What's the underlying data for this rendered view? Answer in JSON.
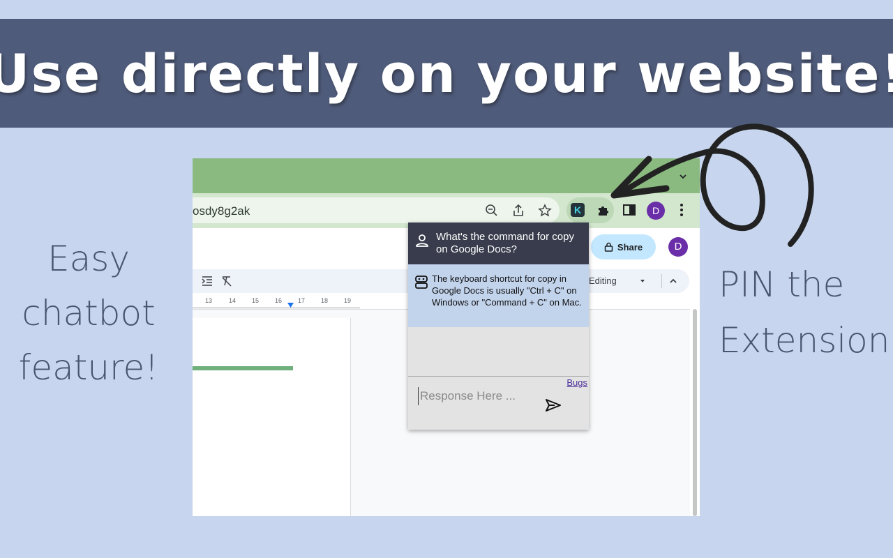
{
  "banner": {
    "title": "Use directly on your website!"
  },
  "left_note": {
    "lines": [
      "Easy",
      "chatbot",
      "feature!"
    ]
  },
  "right_note": {
    "lines": [
      "PIN the",
      "Extension!"
    ]
  },
  "browser": {
    "url": "osdy8g2ak",
    "extension_letter": "K",
    "profile_initial": "D"
  },
  "docs": {
    "share_label": "Share",
    "avatar_initial": "D",
    "mode_label": "Editing",
    "ruler_ticks": [
      "13",
      "14",
      "15",
      "16",
      "17",
      "18",
      "19"
    ]
  },
  "chatbot": {
    "user_message": "What's the command for copy on Google Docs?",
    "bot_message": "The keyboard shortcut for copy in Google Docs is usually \"Ctrl + C\" on Windows or \"Command + C\" on Mac.",
    "bugs_link": "Bugs",
    "input_placeholder": "Response Here ..."
  },
  "colors": {
    "background": "#c7d6ee",
    "banner": "#4f5b7a",
    "tab_bar": "#8aba80",
    "popup_header": "#383c4c",
    "bot_bubble": "#c2d3ec"
  },
  "icons": [
    "zoom-out-icon",
    "share-page-icon",
    "star-icon",
    "extension-k-icon",
    "puzzle-icon",
    "side-panel-icon",
    "kebab-icon",
    "lock-icon",
    "user-icon",
    "robot-icon",
    "send-icon",
    "arrow-annotation"
  ]
}
